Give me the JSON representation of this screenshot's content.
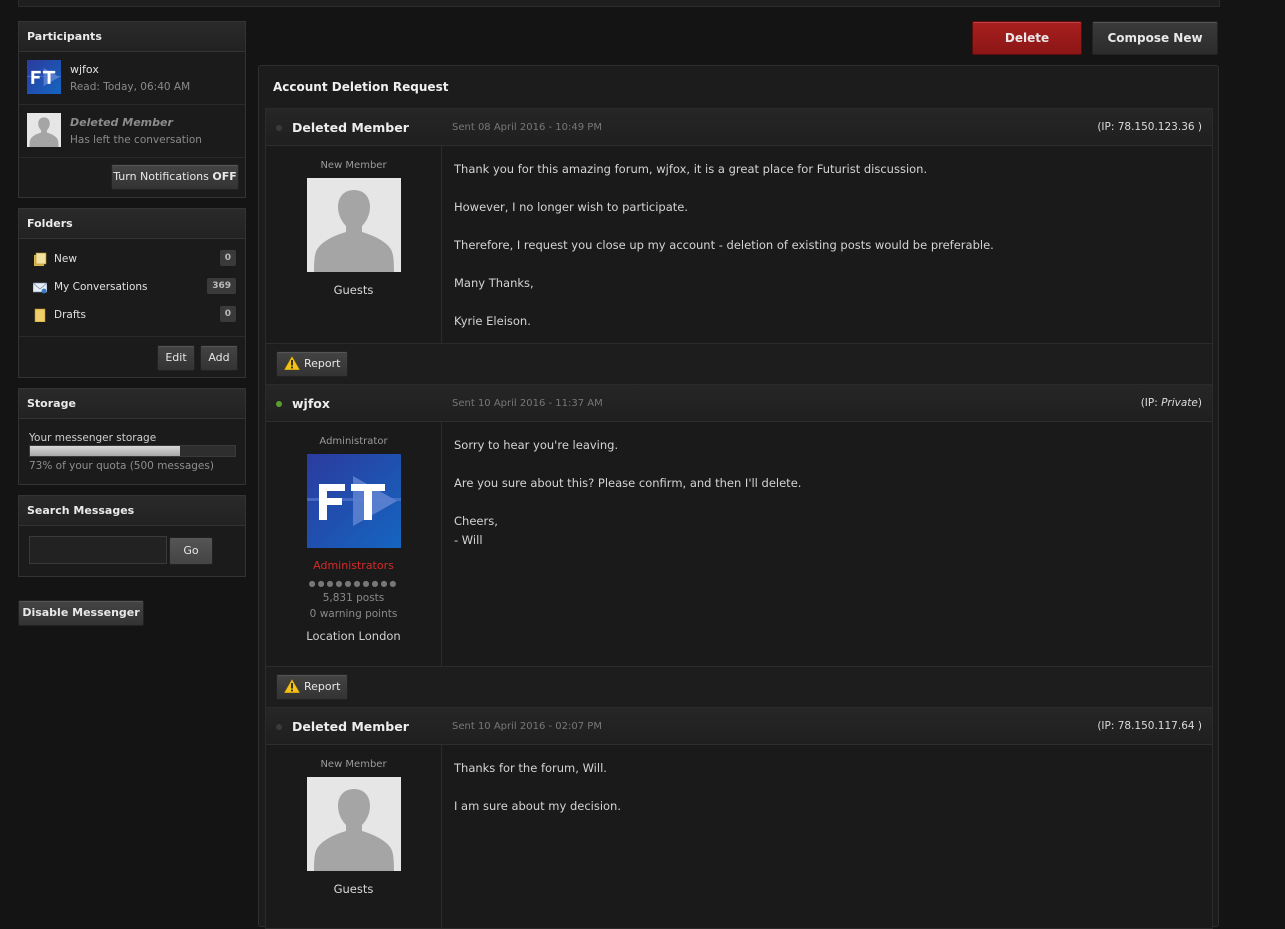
{
  "sidebar": {
    "participants": {
      "title": "Participants",
      "people": [
        {
          "name": "wjfox",
          "status": "Read: Today, 06:40 AM"
        },
        {
          "name": "Deleted Member",
          "status": "Has left the conversation"
        }
      ],
      "notif_label": "Turn Notifications",
      "notif_state": "OFF"
    },
    "folders": {
      "title": "Folders",
      "items": [
        {
          "label": "New",
          "count": "0",
          "icon": "folder-new-icon"
        },
        {
          "label": "My Conversations",
          "count": "369",
          "icon": "mail-icon"
        },
        {
          "label": "Drafts",
          "count": "0",
          "icon": "folder-icon"
        }
      ],
      "edit_label": "Edit",
      "add_label": "Add"
    },
    "storage": {
      "title": "Storage",
      "label": "Your messenger storage",
      "percent": 73,
      "summary": "73% of your quota (500 messages)"
    },
    "search": {
      "title": "Search Messages",
      "value": "",
      "go_label": "Go"
    },
    "disable_label": "Disable Messenger"
  },
  "toolbar": {
    "delete_label": "Delete",
    "compose_label": "Compose New"
  },
  "conversation": {
    "title": "Account Deletion Request",
    "report_label": "Report",
    "posts": [
      {
        "author": "Deleted Member",
        "online": false,
        "date": "Sent 08 April 2016 - 10:49 PM",
        "ip_prefix": "(IP: ",
        "ip": "78.150.123.36",
        "ip_suffix": " )",
        "rank": "New Member",
        "group": "Guests",
        "paragraphs": [
          "Thank you for this amazing forum, wjfox, it is a great place for Futurist discussion.",
          "However, I no longer wish to participate.",
          "Therefore, I request you close up my account - deletion of existing posts would be preferable.",
          "Many Thanks,",
          "Kyrie Eleison."
        ]
      },
      {
        "author": "wjfox",
        "online": true,
        "date": "Sent 10 April 2016 - 11:37 AM",
        "ip_prefix": "(IP: ",
        "ip": "Private",
        "ip_suffix": ")",
        "rank": "Administrator",
        "group": "Administrators",
        "posts_count": "5,831 posts",
        "warning": "0 warning points",
        "location": "Location London",
        "paragraphs": [
          "Sorry to hear you're leaving.",
          "Are you sure about this? Please confirm, and then I'll delete.",
          "Cheers,",
          "- Will"
        ]
      },
      {
        "author": "Deleted Member",
        "online": false,
        "date": "Sent 10 April 2016 - 02:07 PM",
        "ip_prefix": "(IP: ",
        "ip": "78.150.117.64",
        "ip_suffix": " )",
        "rank": "New Member",
        "group": "Guests",
        "paragraphs": [
          "Thanks for the forum, Will.",
          "I am sure about my decision."
        ]
      }
    ]
  },
  "colors": {
    "background": "#141414",
    "delete_button": "#9b1b1b",
    "admin_group": "#d42a2a",
    "online_dot": "#5a9e2e"
  }
}
